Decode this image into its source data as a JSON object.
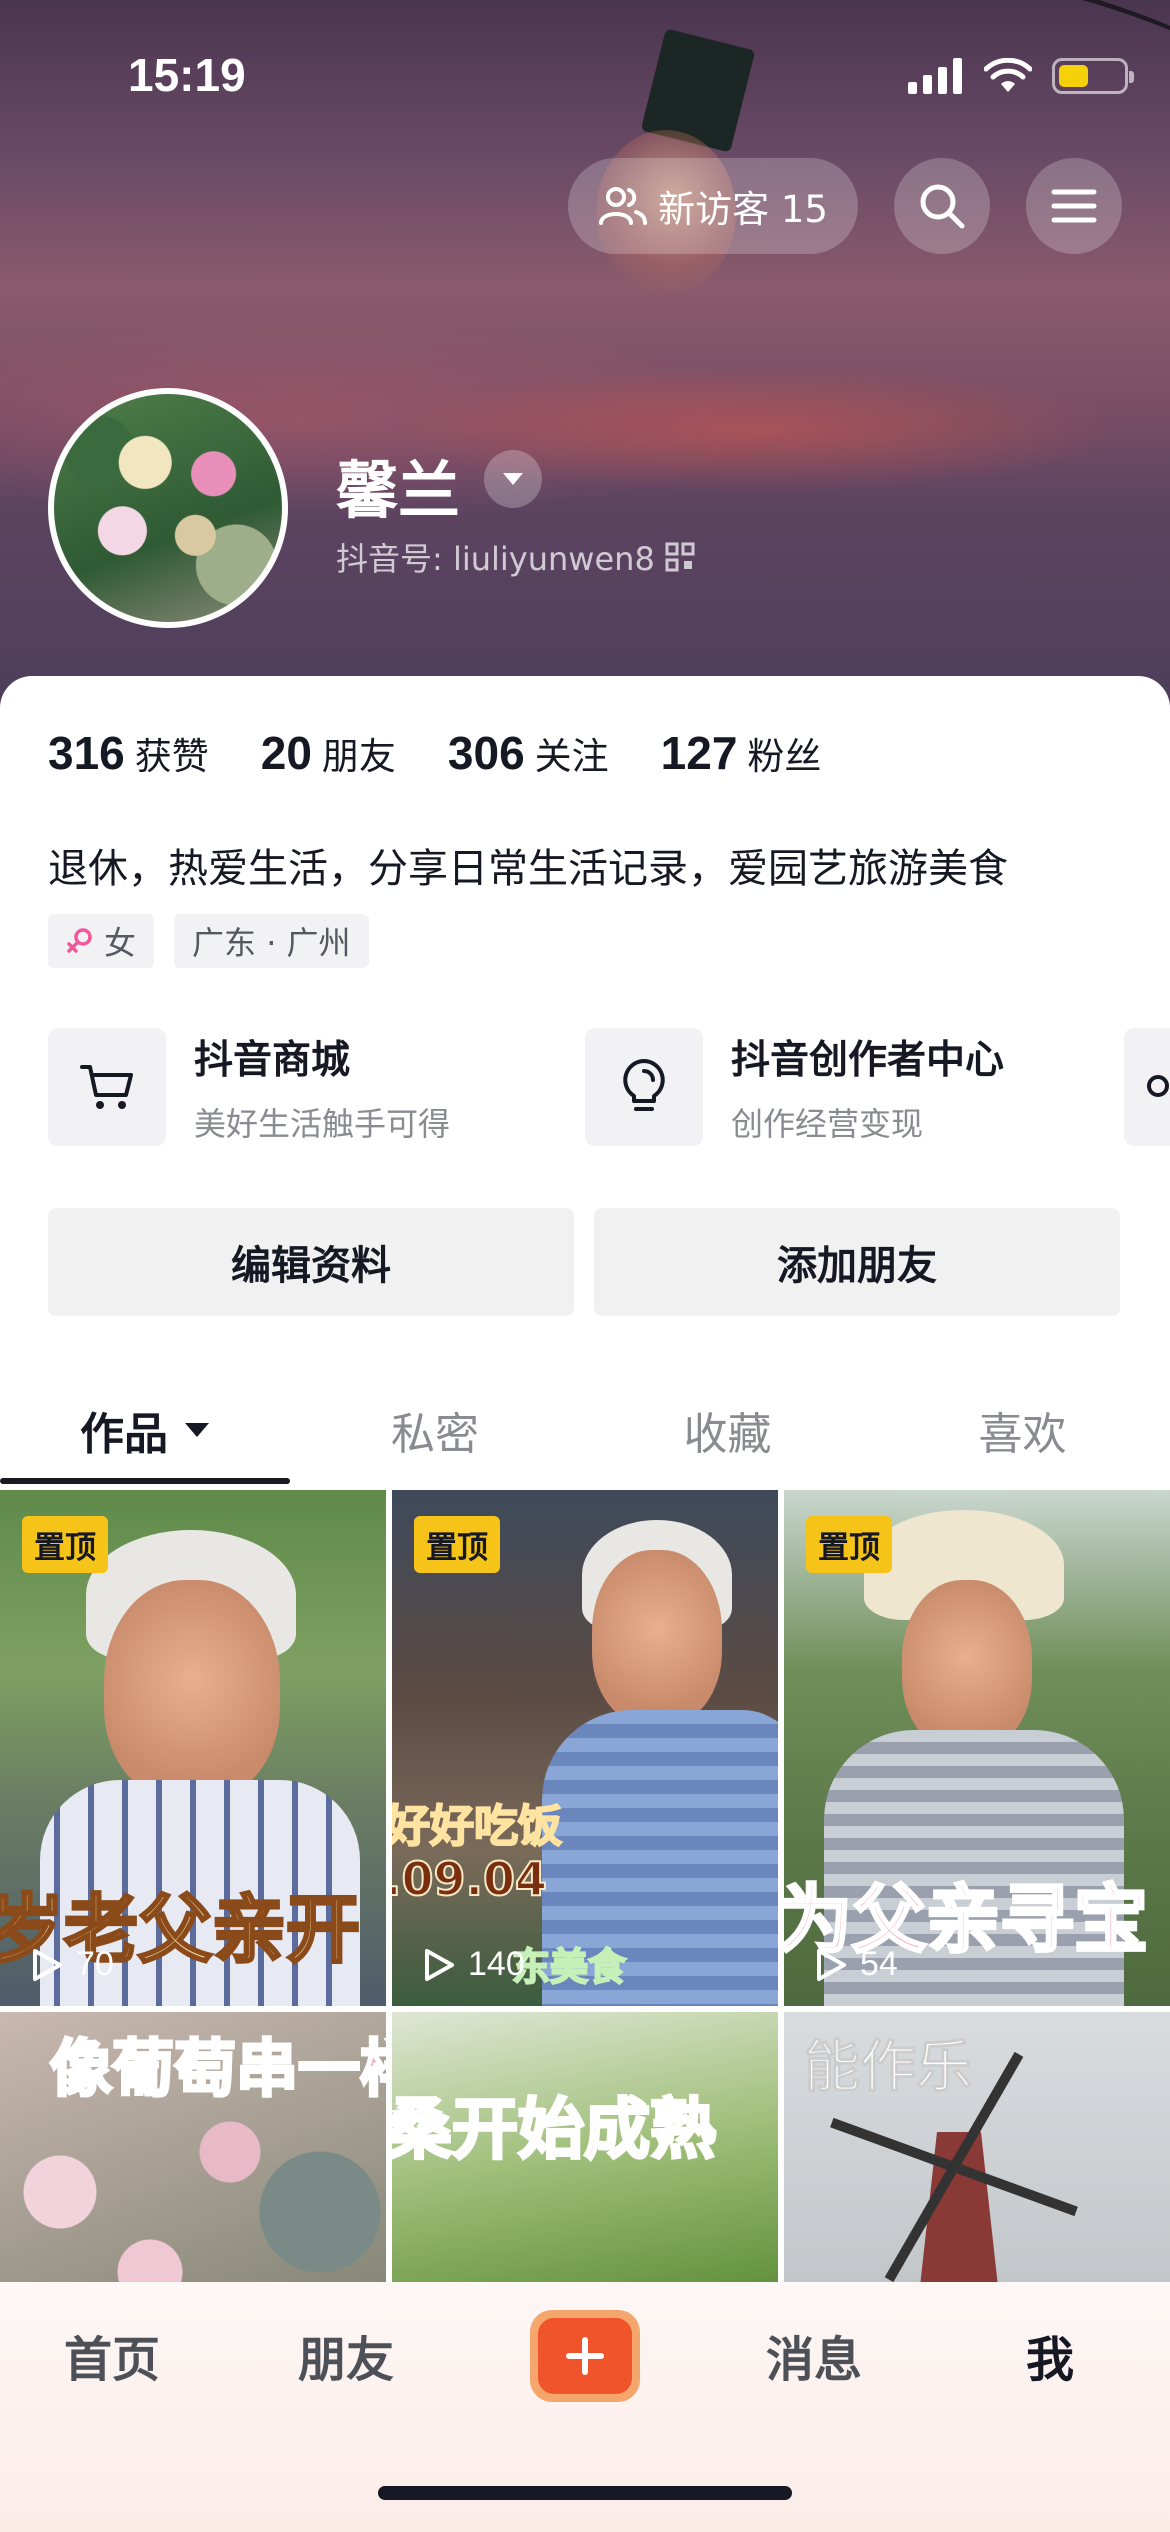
{
  "status_bar": {
    "time": "15:19",
    "battery_color": "#f5d10a"
  },
  "top_actions": {
    "visitors_label": "新访客 15"
  },
  "profile": {
    "nickname": "馨兰",
    "douyin_id": "抖音号: liuliyunwen8",
    "stats": [
      {
        "num": "316",
        "label": "获赞"
      },
      {
        "num": "20",
        "label": "朋友"
      },
      {
        "num": "306",
        "label": "关注"
      },
      {
        "num": "127",
        "label": "粉丝"
      }
    ],
    "bio": "退休，热爱生活，分享日常生活记录，爱园艺旅游美食",
    "tags": {
      "gender": "女",
      "location": "广东 · 广州"
    }
  },
  "services": [
    {
      "title": "抖音商城",
      "subtitle": "美好生活触手可得"
    },
    {
      "title": "抖音创作者中心",
      "subtitle": "创作经营变现"
    }
  ],
  "buttons": {
    "edit_profile": "编辑资料",
    "add_friends": "添加朋友"
  },
  "tabs": [
    {
      "label": "作品"
    },
    {
      "label": "私密"
    },
    {
      "label": "收藏"
    },
    {
      "label": "喜欢"
    }
  ],
  "videos": [
    {
      "pin": "置顶",
      "plays": "70",
      "overlay": "岁老父亲开"
    },
    {
      "pin": "置顶",
      "plays": "140",
      "overlay": "好好吃饭",
      "date": ".09.04",
      "caption": "东美食"
    },
    {
      "pin": "置顶",
      "plays": "54",
      "overlay": "为父亲寻宝"
    },
    {
      "overlay": "像葡萄串一样"
    },
    {
      "overlay": "桑开始成熟"
    },
    {
      "overlay": "能作乐"
    }
  ],
  "bottom_nav": {
    "home": "首页",
    "friends": "朋友",
    "messages": "消息",
    "me": "我",
    "accent": "#f0542a"
  }
}
